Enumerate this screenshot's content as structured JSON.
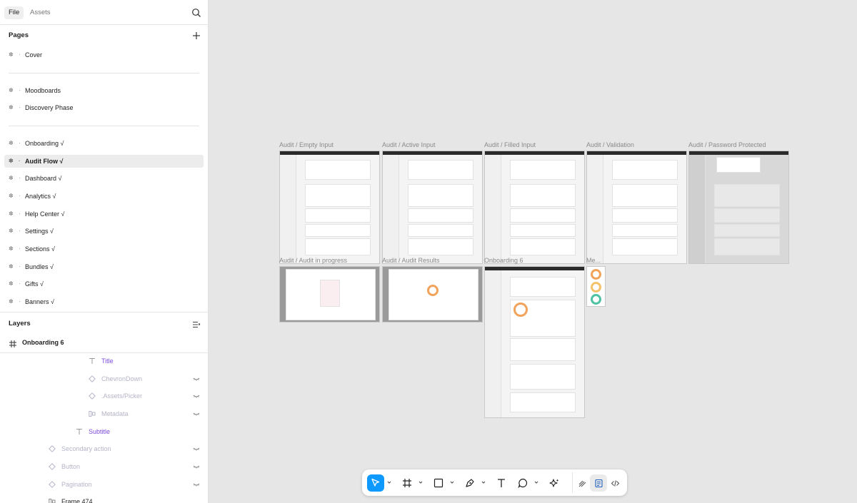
{
  "sidebar": {
    "tabs": [
      {
        "label": "File"
      },
      {
        "label": "Assets"
      }
    ],
    "pages_title": "Pages",
    "pages": [
      {
        "label": "Cover"
      },
      {
        "label": "Moodboards"
      },
      {
        "label": "Discovery Phase"
      },
      {
        "label": "Onboarding √"
      },
      {
        "label": "Audit Flow √"
      },
      {
        "label": "Dashboard √"
      },
      {
        "label": "Analytics √"
      },
      {
        "label": "Help Center √"
      },
      {
        "label": "Settings √"
      },
      {
        "label": "Sections √"
      },
      {
        "label": "Bundles √"
      },
      {
        "label": "Gifts √"
      },
      {
        "label": "Banners √"
      }
    ],
    "layers_title": "Layers",
    "frame_label": "Onboarding 6",
    "layers": [
      {
        "label": "Title"
      },
      {
        "label": "ChevronDown"
      },
      {
        "label": ".Assets/Picker"
      },
      {
        "label": "Metadata"
      },
      {
        "label": "Subtitle"
      },
      {
        "label": "Secondary action"
      },
      {
        "label": "Button"
      },
      {
        "label": "Pagination"
      },
      {
        "label": "Frame 474"
      }
    ]
  },
  "canvas": {
    "frames": [
      {
        "label": "Audit / Empty Input"
      },
      {
        "label": "Audit / Active Input"
      },
      {
        "label": "Audit / Filled Input"
      },
      {
        "label": "Audit / Validation"
      },
      {
        "label": "Audit / Password Protected"
      },
      {
        "label": "Audit / Audit in progress"
      },
      {
        "label": "Audit / Audit Results"
      },
      {
        "label": "Onboarding 6"
      },
      {
        "label": "Me..."
      }
    ]
  },
  "toolbar": {
    "tools": [
      "move-tool",
      "frame-tool",
      "shape-tool",
      "pen-tool",
      "text-tool",
      "comment-tool",
      "actions-tool"
    ],
    "modes": [
      "design-mode",
      "dev-mode",
      "code-mode"
    ]
  },
  "colors": {
    "accent": "#0d99ff",
    "layer_purple": "#7b4ad9"
  }
}
